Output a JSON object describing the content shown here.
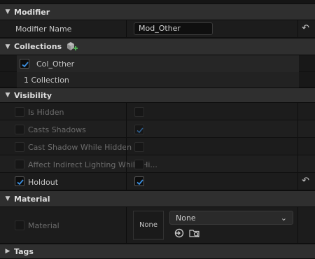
{
  "categories": {
    "modifier": "Modifier",
    "collections": "Collections",
    "visibility": "Visibility",
    "material": "Material",
    "tags": "Tags"
  },
  "modifier": {
    "name_label": "Modifier Name",
    "name_value": "Mod_Other"
  },
  "collections": {
    "item": "Col_Other",
    "count": "1 Collection"
  },
  "visibility": {
    "rows": [
      {
        "label": "Is Hidden",
        "checked": false
      },
      {
        "label": "Casts Shadows",
        "checked": true
      },
      {
        "label": "Cast Shadow While Hidden",
        "checked": false
      },
      {
        "label": "Affect Indirect Lighting While Hi...",
        "checked": false
      },
      {
        "label": "Holdout",
        "checked": true
      }
    ]
  },
  "material": {
    "label": "Material",
    "thumb": "None",
    "dropdown_value": "None"
  },
  "icons": {
    "collapse": "triangle-down-icon",
    "expand": "triangle-right-icon",
    "reset": "reset-arrow-icon",
    "check": "checkmark-icon",
    "add_collection": "add-layer-icon",
    "use_selected": "use-selected-asset-icon",
    "browse": "browse-asset-icon"
  },
  "colors": {
    "accent": "#3b8fe0",
    "add_green": "#4caf50"
  }
}
